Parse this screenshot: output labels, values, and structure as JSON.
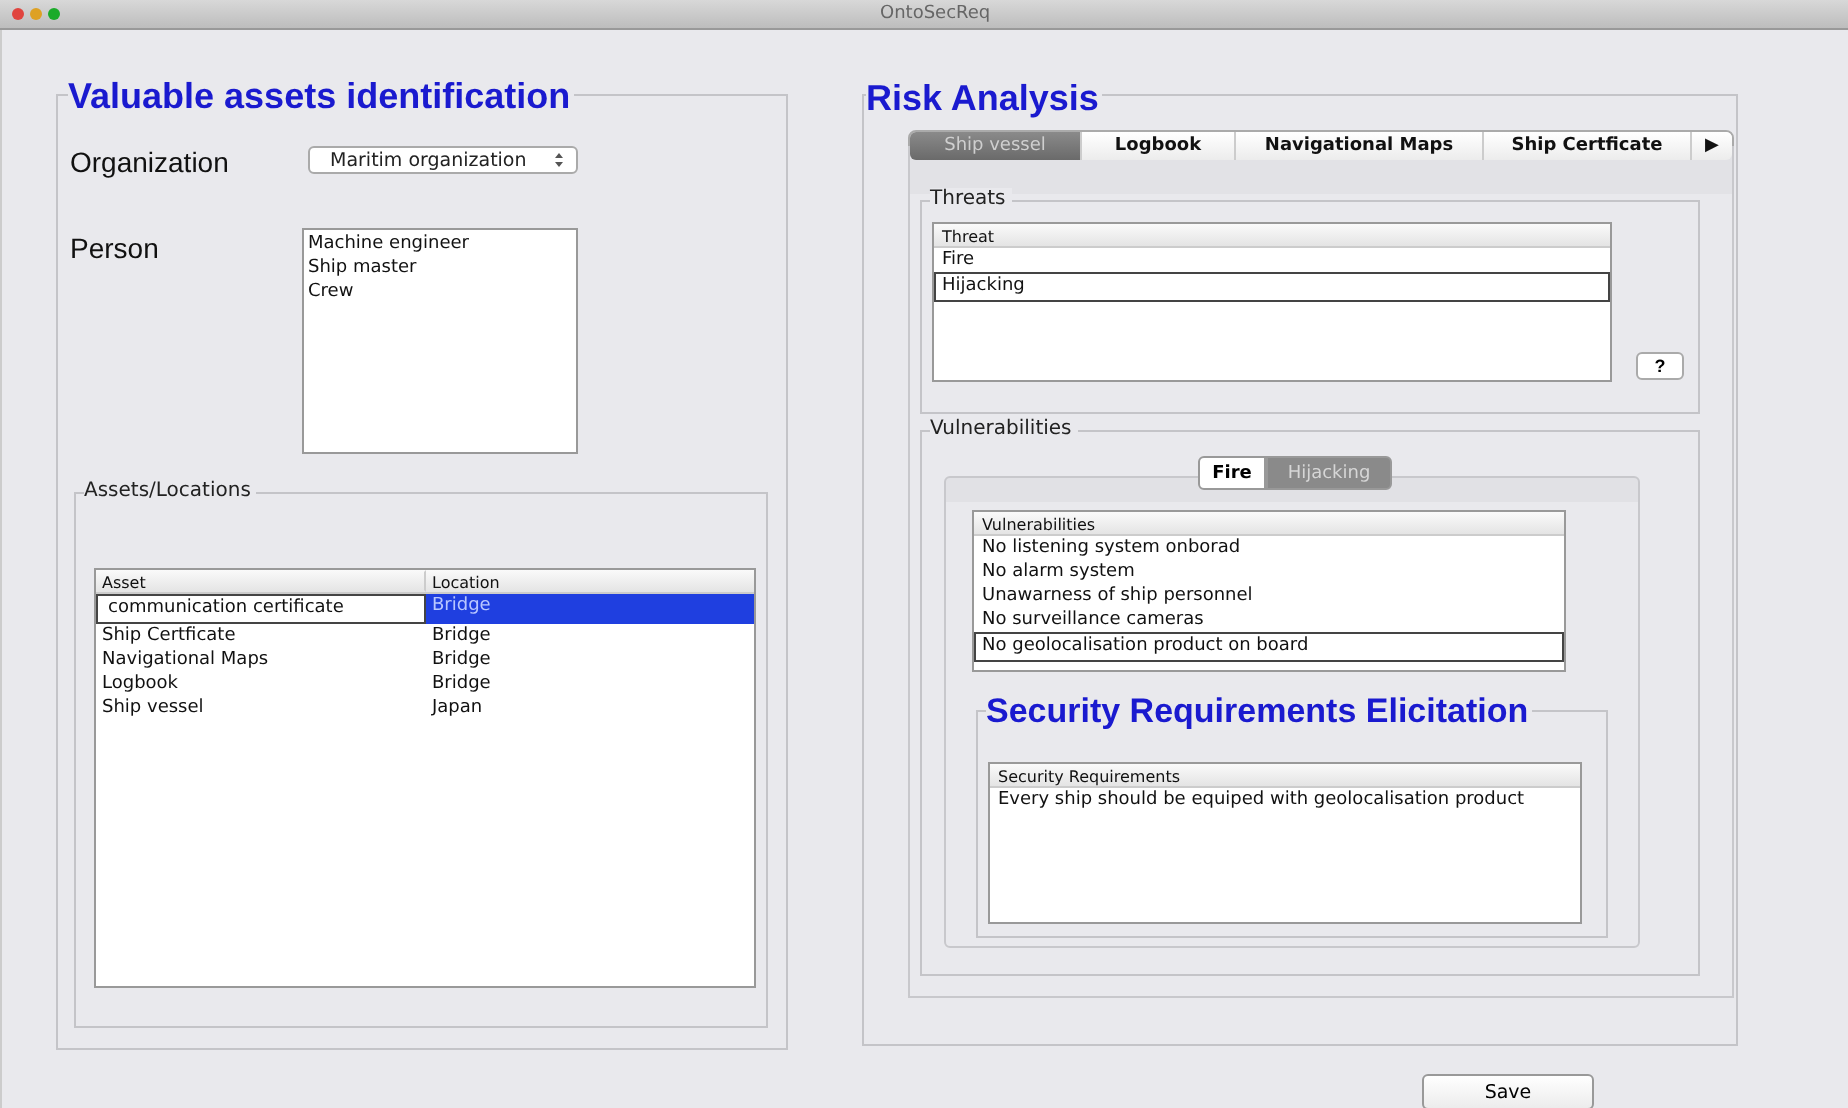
{
  "window": {
    "title": "OntoSecReq"
  },
  "assets_section": {
    "title": "Valuable assets identification",
    "organization": {
      "label": "Organization",
      "value": "Maritim organization"
    },
    "person": {
      "label": "Person",
      "items": [
        "Machine engineer",
        "Ship master",
        "Crew"
      ]
    },
    "assets_locations": {
      "title": "Assets/Locations",
      "columns": [
        "Asset",
        "Location"
      ],
      "rows": [
        {
          "cells": [
            "communication certificate",
            "Bridge"
          ],
          "selected": true
        },
        {
          "cells": [
            "Ship Certficate",
            "Bridge"
          ],
          "selected": false
        },
        {
          "cells": [
            "Navigational Maps",
            "Bridge"
          ],
          "selected": false
        },
        {
          "cells": [
            "Logbook",
            "Bridge"
          ],
          "selected": false
        },
        {
          "cells": [
            "Ship vessel",
            "Japan"
          ],
          "selected": false
        }
      ]
    }
  },
  "risk_section": {
    "title": "Risk Analysis",
    "tabs": [
      {
        "label": "Ship vessel",
        "selected": true
      },
      {
        "label": "Logbook",
        "selected": false
      },
      {
        "label": "Navigational Maps",
        "selected": false
      },
      {
        "label": "Ship Certficate",
        "selected": false
      }
    ],
    "tabs_more": "▶",
    "threats": {
      "title": "Threats",
      "column": "Threat",
      "rows": [
        {
          "text": "Fire",
          "selected": false
        },
        {
          "text": "Hijacking",
          "selected": true
        }
      ],
      "help_button": "?"
    },
    "vulnerabilities": {
      "title": "Vulnerabilities",
      "tabs": [
        {
          "label": "Fire",
          "selected": false
        },
        {
          "label": "Hijacking",
          "selected": true
        }
      ],
      "column": "Vulnerabilities",
      "rows": [
        {
          "text": "No listening system onborad",
          "selected": false
        },
        {
          "text": "No alarm system",
          "selected": false
        },
        {
          "text": "Unawarness of ship personnel",
          "selected": false
        },
        {
          "text": "No surveillance cameras",
          "selected": false
        },
        {
          "text": "No geolocalisation product on board",
          "selected": true
        }
      ]
    },
    "security_requirements": {
      "title": "Security Requirements Elicitation",
      "column": "Security Requirements",
      "rows": [
        "Every ship should be equiped with geolocalisation product"
      ]
    }
  },
  "save_button": "Save"
}
